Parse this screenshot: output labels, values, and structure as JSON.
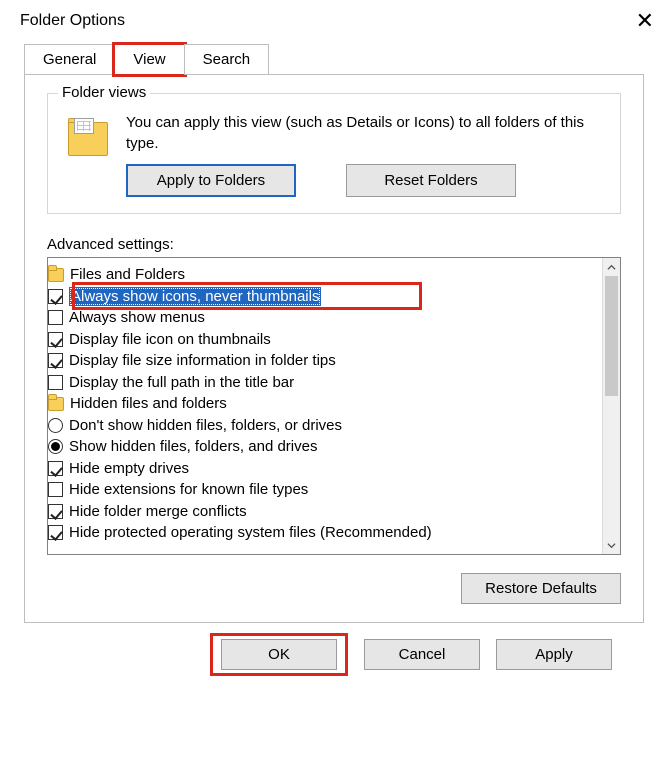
{
  "title": "Folder Options",
  "tabs": {
    "general": "General",
    "view": "View",
    "search": "Search"
  },
  "folderViews": {
    "legend": "Folder views",
    "desc": "You can apply this view (such as Details or Icons) to all folders of this type.",
    "applyToFolders": "Apply to Folders",
    "resetFolders": "Reset Folders"
  },
  "advancedLabel": "Advanced settings:",
  "tree": {
    "filesAndFolders": "Files and Folders",
    "alwaysShowIcons": "Always show icons, never thumbnails",
    "alwaysShowMenus": "Always show menus",
    "displayFileIcon": "Display file icon on thumbnails",
    "displayFileSize": "Display file size information in folder tips",
    "displayFullPath": "Display the full path in the title bar",
    "hiddenFilesFolders": "Hidden files and folders",
    "dontShowHidden": "Don't show hidden files, folders, or drives",
    "showHidden": "Show hidden files, folders, and drives",
    "hideEmptyDrives": "Hide empty drives",
    "hideExtensions": "Hide extensions for known file types",
    "hideFolderMerge": "Hide folder merge conflicts",
    "hideProtectedOS": "Hide protected operating system files (Recommended)"
  },
  "buttons": {
    "restoreDefaults": "Restore Defaults",
    "ok": "OK",
    "cancel": "Cancel",
    "apply": "Apply"
  }
}
